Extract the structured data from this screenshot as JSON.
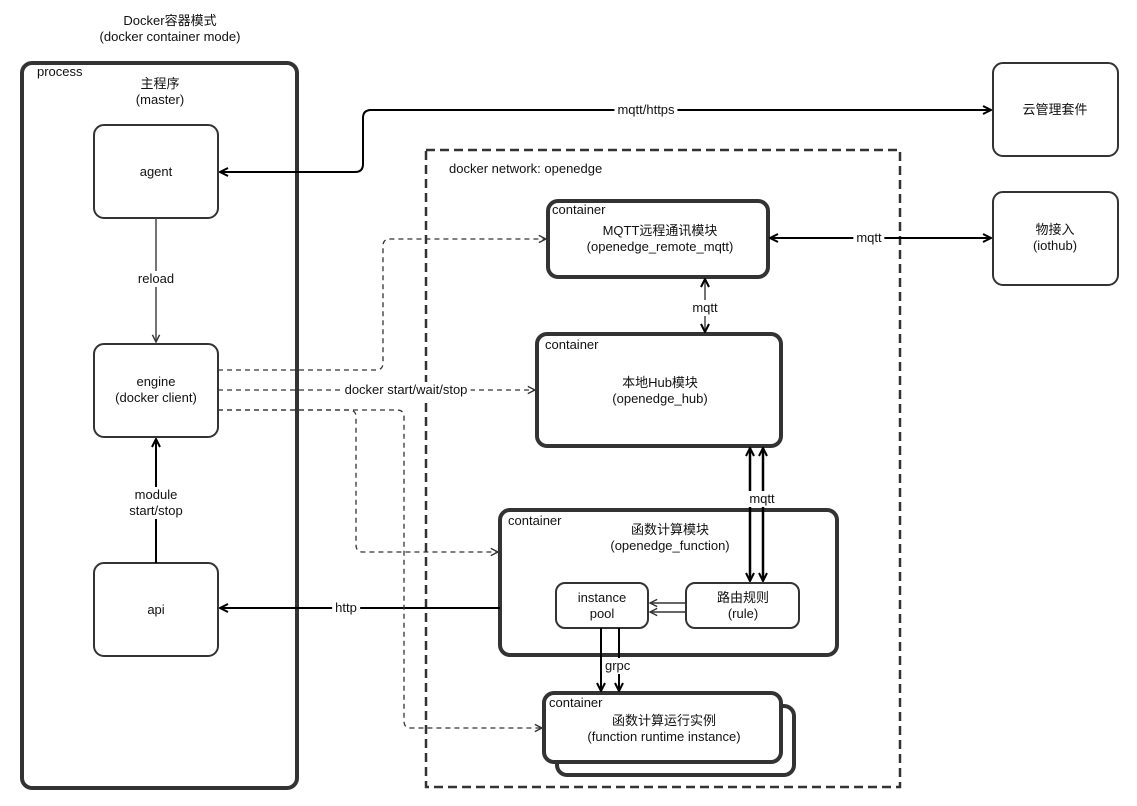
{
  "title": {
    "line1": "Docker容器模式",
    "line2": "(docker container mode)"
  },
  "process_box": {
    "tag": "process",
    "name_line1": "主程序",
    "name_line2": "(master)",
    "agent": "agent",
    "engine_line1": "engine",
    "engine_line2": "(docker client)",
    "api": "api"
  },
  "edges": {
    "reload": "reload",
    "module_line1": "module",
    "module_line2": "start/stop",
    "mqtt_https": "mqtt/https",
    "docker_cmd": "docker start/wait/stop",
    "http": "http",
    "mqtt_remote_iothub": "mqtt",
    "mqtt_remote_hub": "mqtt",
    "mqtt_hub_rule": "mqtt",
    "grpc": "grpc"
  },
  "network": {
    "label": "docker network: openedge"
  },
  "containers": {
    "tag": "container",
    "remote_mqtt_line1": "MQTT远程通讯模块",
    "remote_mqtt_line2": "(openedge_remote_mqtt)",
    "hub_line1": "本地Hub模块",
    "hub_line2": "(openedge_hub)",
    "function_line1": "函数计算模块",
    "function_line2": "(openedge_function)",
    "instance_pool_line1": "instance",
    "instance_pool_line2": "pool",
    "rule_line1": "路由规则",
    "rule_line2": "(rule)",
    "runtime_line1": "函数计算运行实例",
    "runtime_line2": "(function runtime instance)"
  },
  "external": {
    "cloud": "云管理套件",
    "iothub_line1": "物接入",
    "iothub_line2": "(iothub)"
  },
  "colors": {
    "stroke": "#333333",
    "line": "#000000",
    "dashed": "#333333"
  }
}
